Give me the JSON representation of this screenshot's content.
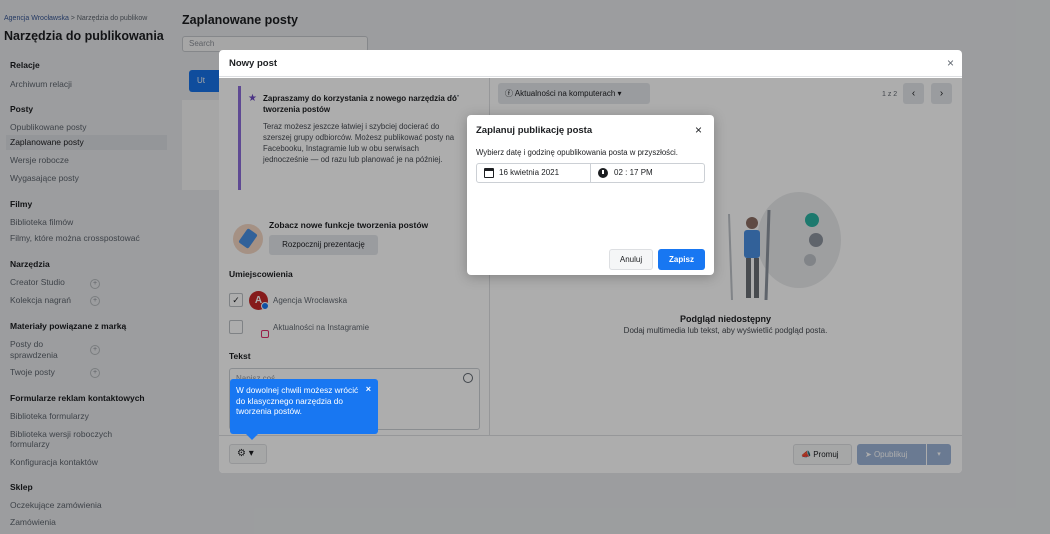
{
  "breadcrumb": {
    "org": "Agencja Wrocławska",
    "sep": ">",
    "current": "Narzędzia do publikow"
  },
  "sidebar": {
    "title": "Narzędzia do publikowania",
    "items": [
      {
        "type": "head",
        "label": "Relacje"
      },
      {
        "type": "item",
        "label": "Archiwum relacji"
      },
      {
        "type": "head",
        "label": "Posty"
      },
      {
        "type": "item",
        "label": "Opublikowane posty"
      },
      {
        "type": "active",
        "label": "Zaplanowane posty"
      },
      {
        "type": "item",
        "label": "Wersje robocze"
      },
      {
        "type": "item",
        "label": "Wygasające posty"
      },
      {
        "type": "head",
        "label": "Filmy"
      },
      {
        "type": "item",
        "label": "Biblioteka filmów"
      },
      {
        "type": "item",
        "label": "Filmy, które można crosspostować"
      },
      {
        "type": "head",
        "label": "Narzędzia"
      },
      {
        "type": "item",
        "label": "Creator Studio"
      },
      {
        "type": "item",
        "label": "Kolekcja nagrań"
      },
      {
        "type": "head",
        "label": "Materiały powiązane z marką"
      },
      {
        "type": "item",
        "label": "Posty do"
      },
      {
        "type": "item",
        "label": "sprawdzenia"
      },
      {
        "type": "item",
        "label": "Twoje posty"
      },
      {
        "type": "head",
        "label": "Formularze reklam kontaktowych"
      },
      {
        "type": "item",
        "label": "Biblioteka formularzy"
      },
      {
        "type": "item",
        "label": "Biblioteka wersji roboczych"
      },
      {
        "type": "item",
        "label": "formularzy"
      },
      {
        "type": "item",
        "label": "Konfiguracja kontaktów"
      },
      {
        "type": "head",
        "label": "Sklep"
      },
      {
        "type": "item",
        "label": "Oczekujące zamówienia"
      },
      {
        "type": "item",
        "label": "Zamówienia"
      }
    ],
    "plus_glyph": "+"
  },
  "background": {
    "page_title": "Zaplanowane posty",
    "search_placeholder": "Search",
    "create_label": "Ut"
  },
  "composer": {
    "title": "Nowy post",
    "close_glyph": "×",
    "info": {
      "title": "Zapraszamy do korzystania z nowego narzędzia do tworzenia postów",
      "text": "Teraz możesz jeszcze łatwiej i szybciej docierać do szerszej grupy odbiorców. Możesz publikować posty na Facebooku, Instagramie lub w obu serwisach jednocześnie — od razu lub planować je na później.",
      "menu_glyph": "···",
      "star_glyph": "★"
    },
    "promo": {
      "title": "Zobacz nowe funkcje tworzenia postów",
      "button": "Rozpocznij prezentację",
      "chevron": "›"
    },
    "placements_label": "Umiejscowienia",
    "placements": [
      {
        "name": "Agencja Wrocławska",
        "checked": "✓",
        "avatar": "A"
      },
      {
        "name": "Aktualności na Instagramie",
        "checked": ""
      }
    ],
    "text_label": "Tekst",
    "text_placeholder": "Napisz coś...",
    "tooltip": {
      "text": "W dowolnej chwili możesz wrócić do klasycznego narzędzia do tworzenia postów.",
      "close": "×"
    },
    "gear": "⚙ ▾"
  },
  "preview": {
    "placement": "Aktualności na komputerach",
    "placement_icon": "ⓕ",
    "dropdown_glyph": "▾",
    "pager": "1 z 2",
    "prev_glyph": "‹",
    "next_glyph": "›",
    "unavailable_title": "Podgląd niedostępny",
    "unavailable_text": "Dodaj multimedia lub tekst, aby wyświetlić podgląd posta."
  },
  "footer": {
    "promote": "Promuj",
    "promote_icon": "📣",
    "publish": "Opublikuj",
    "publish_icon": "➤",
    "publish_dd": "▾"
  },
  "schedule": {
    "title": "Zaplanuj publikację posta",
    "close_glyph": "×",
    "description": "Wybierz datę i godzinę opublikowania posta w przyszłości.",
    "date": "16 kwietnia 2021",
    "time": "02 : 17 PM",
    "cancel": "Anuluj",
    "save": "Zapisz"
  },
  "colors": {
    "accent": "#1877f2",
    "purple": "#8b6cd9",
    "publish_disabled": "#9cb4d8"
  }
}
